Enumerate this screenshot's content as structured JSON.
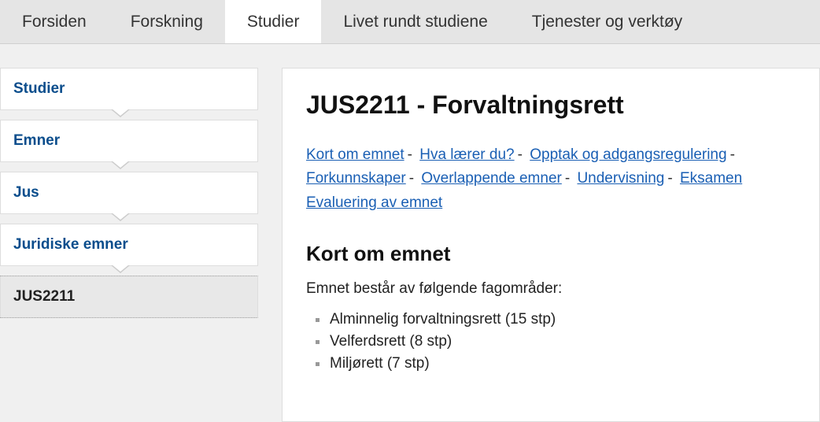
{
  "topTabs": [
    {
      "label": "Forsiden",
      "active": false
    },
    {
      "label": "Forskning",
      "active": false
    },
    {
      "label": "Studier",
      "active": true
    },
    {
      "label": "Livet rundt studiene",
      "active": false
    },
    {
      "label": "Tjenester og verktøy",
      "active": false
    }
  ],
  "breadcrumbs": [
    {
      "label": "Studier",
      "link": true
    },
    {
      "label": "Emner",
      "link": true
    },
    {
      "label": "Jus",
      "link": true
    },
    {
      "label": "Juridiske emner",
      "link": true
    },
    {
      "label": "JUS2211",
      "link": false
    }
  ],
  "page": {
    "title": "JUS2211 - Forvaltningsrett",
    "anchors": [
      "Kort om emnet",
      "Hva lærer du?",
      "Opptak og adgangsregulering",
      "Forkunnskaper",
      "Overlappende emner",
      "Undervisning",
      "Eksamen",
      "Evaluering av emnet"
    ],
    "section": {
      "heading": "Kort om emnet",
      "intro": "Emnet består av følgende fagområder:",
      "bullets": [
        "Alminnelig forvaltningsrett (15 stp)",
        "Velferdsrett (8 stp)",
        "Miljørett (7 stp)"
      ]
    }
  }
}
